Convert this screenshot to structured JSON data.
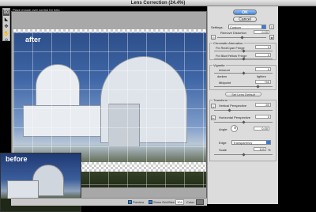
{
  "window": {
    "title": "Lens Correction (24.4%)"
  },
  "tools": [
    {
      "name": "remove-distortion-tool-icon",
      "glyph": "⌧"
    },
    {
      "name": "straighten-tool-icon",
      "glyph": "◣"
    },
    {
      "name": "move-grid-tool-icon",
      "glyph": "✥"
    },
    {
      "name": "hand-tool-icon",
      "glyph": "✋"
    },
    {
      "name": "zoom-tool-icon",
      "glyph": "⚲"
    }
  ],
  "hint": "Place mouse over control for help",
  "labels": {
    "after": "after",
    "before": "before"
  },
  "statusbar": {
    "preview": "Preview",
    "show_grid": "Show Grid",
    "size_label": "Size:",
    "size_value": "104",
    "color_label": "Color:"
  },
  "buttons": {
    "ok": "OK",
    "cancel": "Cancel"
  },
  "settings": {
    "label": "Settings:",
    "value": "Custom"
  },
  "remove_distortion": {
    "label": "Remove Distortion",
    "value": "0.00"
  },
  "chromatic": {
    "title": "Chromatic Aberration",
    "fix_red_cyan": {
      "label": "Fix Red/Cyan Fringe",
      "value": "0"
    },
    "fix_blue_yellow": {
      "label": "Fix Blue/Yellow Fringe",
      "value": "0"
    }
  },
  "vignette": {
    "title": "Vignette",
    "amount": {
      "label": "Amount",
      "value": "0"
    },
    "darken": "darken",
    "lighten": "lighten",
    "midpoint": {
      "label": "Midpoint",
      "value": "+50"
    }
  },
  "set_lens_default": "Set Lens Default",
  "transform": {
    "title": "Transform",
    "vertical": {
      "label": "Vertical Perspective",
      "value": "-50"
    },
    "horizontal": {
      "label": "Horizontal Perspective",
      "value": "0"
    },
    "angle": {
      "label": "Angle:",
      "value": "0.00"
    },
    "edge": {
      "label": "Edge:",
      "value": "Transparency"
    },
    "scale": {
      "label": "Scale",
      "value": "100",
      "unit": "%"
    }
  }
}
